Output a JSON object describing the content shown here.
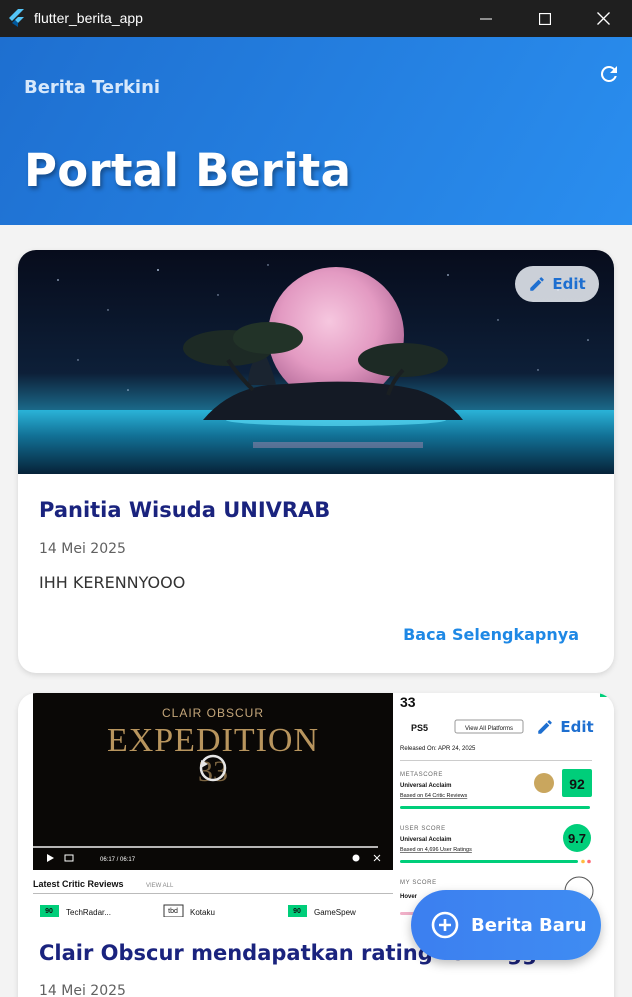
{
  "window": {
    "title": "flutter_berita_app"
  },
  "appbar": {
    "subtitle": "Berita Terkini",
    "title": "Portal Berita",
    "refresh_icon": "refresh-icon"
  },
  "articles": [
    {
      "title": "Panitia Wisuda UNIVRAB",
      "date": "14 Mei 2025",
      "body": "IHH KERENNYOOO",
      "read_more": "Baca Selengkapnya",
      "edit_label": "Edit"
    },
    {
      "title": "Clair Obscur mendapatkan rating tertinggi",
      "date": "14 Mei 2025",
      "edit_label": "Edit",
      "image_text": {
        "game_title_small": "CLAIR OBSCUR",
        "game_title_big": "EXPEDITION",
        "video_time": "06:17 / 06:17",
        "page_number": "33",
        "platform": "PS5",
        "view_platforms": "View All Platforms",
        "released": "Released On: APR 24, 2025",
        "metascore_label": "METASCORE",
        "metascore_verdict": "Universal Acclaim",
        "metascore_based": "Based on 64 Critic Reviews",
        "metascore_value": "92",
        "userscore_label": "USER SCORE",
        "userscore_verdict": "Universal Acclaim",
        "userscore_based": "Based on 4,696 User Ratings",
        "userscore_value": "9.7",
        "myscore_label": "MY SCORE",
        "myscore_hover": "Hover",
        "critic_heading": "Latest Critic Reviews",
        "view_all": "VIEW ALL",
        "critics": [
          {
            "score": "90",
            "name": "TechRadar..."
          },
          {
            "score": "tbd",
            "name": "Kotaku"
          },
          {
            "score": "90",
            "name": "GameSpew"
          }
        ]
      }
    }
  ],
  "fab": {
    "label": "Berita Baru"
  },
  "colors": {
    "appbar_start": "#1e6fd0",
    "appbar_end": "#2a8eef",
    "title_text": "#1a237e",
    "accent": "#1e88e5",
    "score_green": "#00ce7a"
  }
}
